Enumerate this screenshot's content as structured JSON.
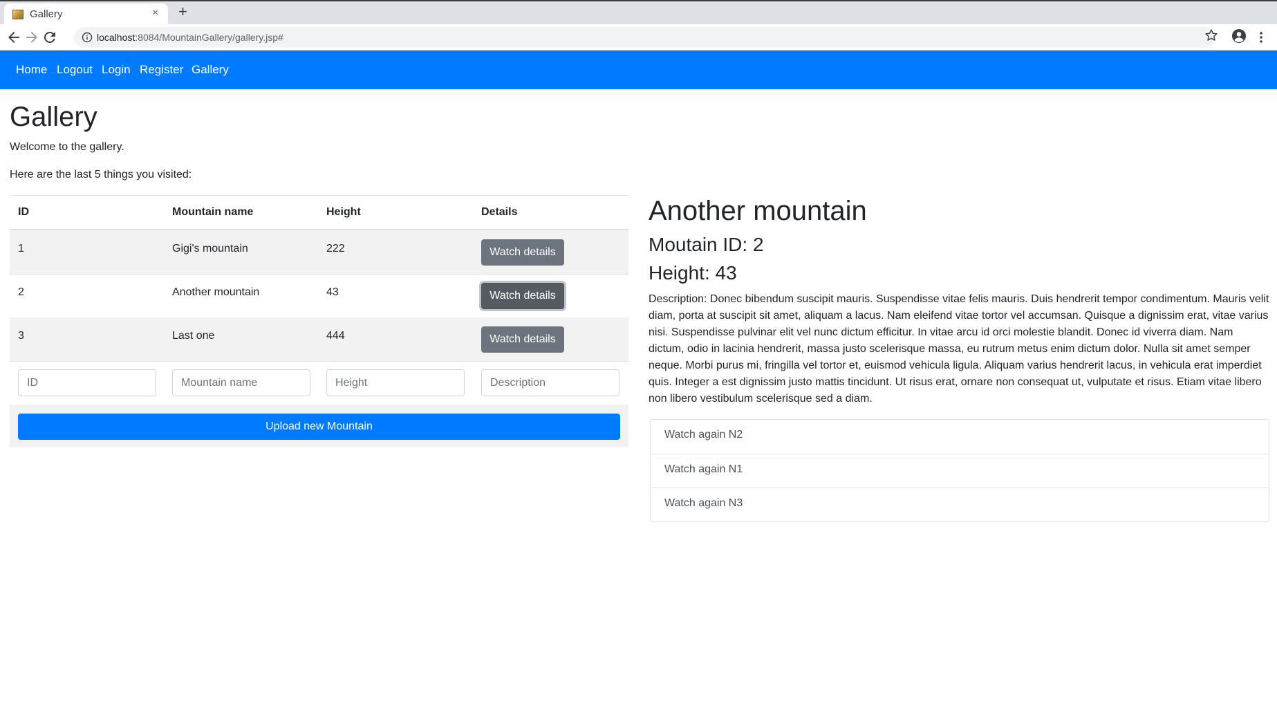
{
  "browser": {
    "tab_title": "Gallery",
    "tab_close": "×",
    "new_tab": "+",
    "url_host": "localhost",
    "url_rest": ":8084/MountainGallery/gallery.jsp#"
  },
  "navbar": {
    "links": [
      "Home",
      "Logout",
      "Login",
      "Register",
      "Gallery"
    ],
    "background": "#007bff"
  },
  "page": {
    "title": "Gallery",
    "welcome": "Welcome to the gallery.",
    "last_visited": "Here are the last 5 things you visited:"
  },
  "table": {
    "headers": [
      "ID",
      "Mountain name",
      "Height",
      "Details"
    ],
    "rows": [
      {
        "id": "1",
        "name": "Gigi's mountain",
        "height": "222",
        "button": "Watch details"
      },
      {
        "id": "2",
        "name": "Another mountain",
        "height": "43",
        "button": "Watch details"
      },
      {
        "id": "3",
        "name": "Last one",
        "height": "444",
        "button": "Watch details"
      }
    ],
    "active_row": 2
  },
  "form": {
    "id_placeholder": "ID",
    "name_placeholder": "Mountain name",
    "height_placeholder": "Height",
    "description_placeholder": "Description",
    "upload_label": "Upload new Mountain"
  },
  "detail": {
    "title": "Another mountain",
    "id_line": "Moutain ID: 2",
    "height_line": "Height: 43",
    "description": "Description: Donec bibendum suscipit mauris. Suspendisse vitae felis mauris. Duis hendrerit tempor condimentum. Mauris velit diam, porta at suscipit sit amet, aliquam a lacus. Nam eleifend vitae tortor vel accumsan. Quisque a dignissim erat, vitae varius nisi. Suspendisse pulvinar elit vel nunc dictum efficitur. In vitae arcu id orci molestie blandit. Donec id viverra diam. Nam dictum, odio in lacinia hendrerit, massa justo scelerisque massa, eu rutrum metus enim dictum dolor. Nulla sit amet semper neque. Morbi purus mi, fringilla vel tortor et, euismod vehicula ligula. Aliquam varius hendrerit lacus, in vehicula erat imperdiet quis. Integer a est dignissim justo mattis tincidunt. Ut risus erat, ornare non consequat ut, vulputate et risus. Etiam vitae libero non libero vestibulum scelerisque sed a diam."
  },
  "history": [
    "Watch again N2",
    "Watch again N1",
    "Watch again N3"
  ],
  "colors": {
    "primary": "#007bff",
    "secondary": "#6c757d",
    "text": "#212529"
  }
}
